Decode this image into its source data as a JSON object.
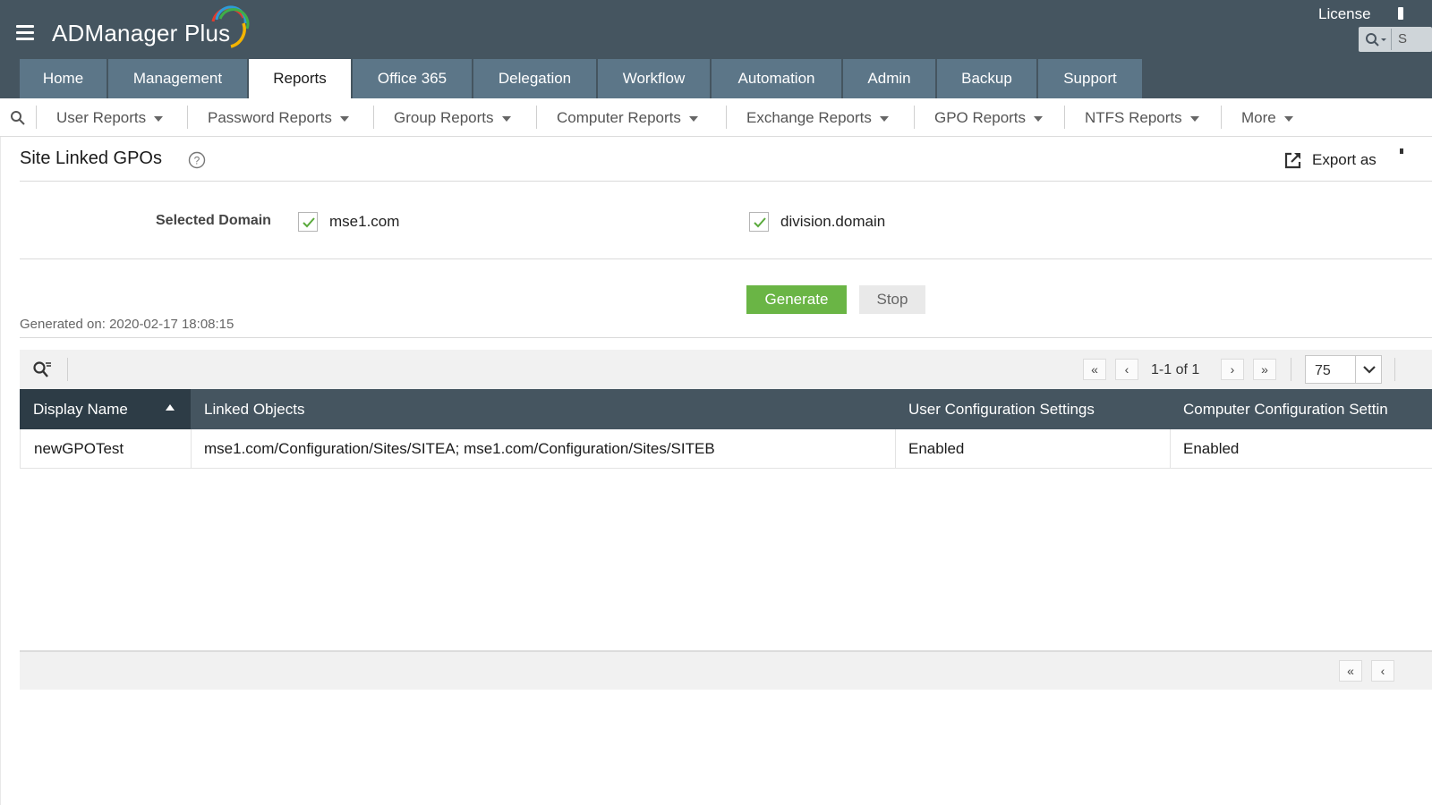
{
  "app": {
    "name": "ADManager Plus",
    "license_label": "License",
    "search_text": "S"
  },
  "main_tabs": [
    {
      "label": "Home",
      "active": false
    },
    {
      "label": "Management",
      "active": false
    },
    {
      "label": "Reports",
      "active": true
    },
    {
      "label": "Office 365",
      "active": false
    },
    {
      "label": "Delegation",
      "active": false
    },
    {
      "label": "Workflow",
      "active": false
    },
    {
      "label": "Automation",
      "active": false
    },
    {
      "label": "Admin",
      "active": false
    },
    {
      "label": "Backup",
      "active": false
    },
    {
      "label": "Support",
      "active": false
    }
  ],
  "sub_nav": [
    {
      "label": "User Reports"
    },
    {
      "label": "Password Reports"
    },
    {
      "label": "Group Reports"
    },
    {
      "label": "Computer Reports"
    },
    {
      "label": "Exchange Reports"
    },
    {
      "label": "GPO Reports"
    },
    {
      "label": "NTFS Reports"
    },
    {
      "label": "More"
    }
  ],
  "page": {
    "title": "Site Linked GPOs",
    "export_label": "Export as"
  },
  "domain_selector": {
    "label": "Selected Domain",
    "domains": [
      {
        "name": "mse1.com",
        "checked": true
      },
      {
        "name": "division.domain",
        "checked": true
      }
    ]
  },
  "actions": {
    "generate_label": "Generate",
    "stop_label": "Stop"
  },
  "generated_on": "Generated on: 2020-02-17 18:08:15",
  "pagination": {
    "info": "1-1 of 1",
    "page_size": "75"
  },
  "table": {
    "columns": [
      "Display Name",
      "Linked Objects",
      "User Configuration Settings",
      "Computer Configuration Settin"
    ],
    "sort_column": "Display Name",
    "rows": [
      [
        "newGPOTest",
        "mse1.com/Configuration/Sites/SITEA; mse1.com/Configuration/Sites/SITEB",
        "Enabled",
        "Enabled"
      ]
    ]
  },
  "colors": {
    "header_bg": "#455560",
    "tab_bg": "#5c7688",
    "generate_green": "#6ab545",
    "sorted_header_bg": "#2d3c46"
  }
}
